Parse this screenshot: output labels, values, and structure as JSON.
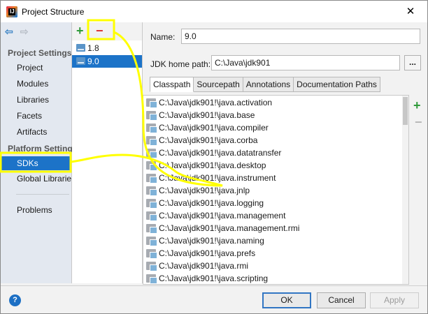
{
  "window": {
    "title": "Project Structure",
    "close_glyph": "✕"
  },
  "nav": {
    "back_glyph": "⇦",
    "forward_glyph": "⇨",
    "section_project": "Project Settings",
    "project_items": [
      "Project",
      "Modules",
      "Libraries",
      "Facets",
      "Artifacts"
    ],
    "section_platform": "Platform Settings",
    "platform_items": [
      "SDKs",
      "Global Libraries"
    ],
    "problems": "Problems",
    "selected": "SDKs"
  },
  "sdk_toolbar": {
    "add_glyph": "+",
    "remove_glyph": "−"
  },
  "sdks": [
    {
      "name": "1.8",
      "selected": false
    },
    {
      "name": "9.0",
      "selected": true
    }
  ],
  "form": {
    "name_label": "Name:",
    "name_value": "9.0",
    "jdk_label": "JDK home path:",
    "jdk_value": "C:\\Java\\jdk901",
    "browse_label": "..."
  },
  "tabs": [
    "Classpath",
    "Sourcepath",
    "Annotations",
    "Documentation Paths"
  ],
  "active_tab": "Classpath",
  "classpath": [
    "C:\\Java\\jdk901!\\java.activation",
    "C:\\Java\\jdk901!\\java.base",
    "C:\\Java\\jdk901!\\java.compiler",
    "C:\\Java\\jdk901!\\java.corba",
    "C:\\Java\\jdk901!\\java.datatransfer",
    "C:\\Java\\jdk901!\\java.desktop",
    "C:\\Java\\jdk901!\\java.instrument",
    "C:\\Java\\jdk901!\\java.jnlp",
    "C:\\Java\\jdk901!\\java.logging",
    "C:\\Java\\jdk901!\\java.management",
    "C:\\Java\\jdk901!\\java.management.rmi",
    "C:\\Java\\jdk901!\\java.naming",
    "C:\\Java\\jdk901!\\java.prefs",
    "C:\\Java\\jdk901!\\java.rmi",
    "C:\\Java\\jdk901!\\java.scripting"
  ],
  "side_toolbar": {
    "add_glyph": "+",
    "remove_glyph": "−"
  },
  "buttons": {
    "help_glyph": "?",
    "ok": "OK",
    "cancel": "Cancel",
    "apply": "Apply"
  },
  "colors": {
    "selection": "#1c73c8",
    "annotation": "#ffff00",
    "add_green": "#2f9a3a",
    "remove_red": "#d33333"
  }
}
